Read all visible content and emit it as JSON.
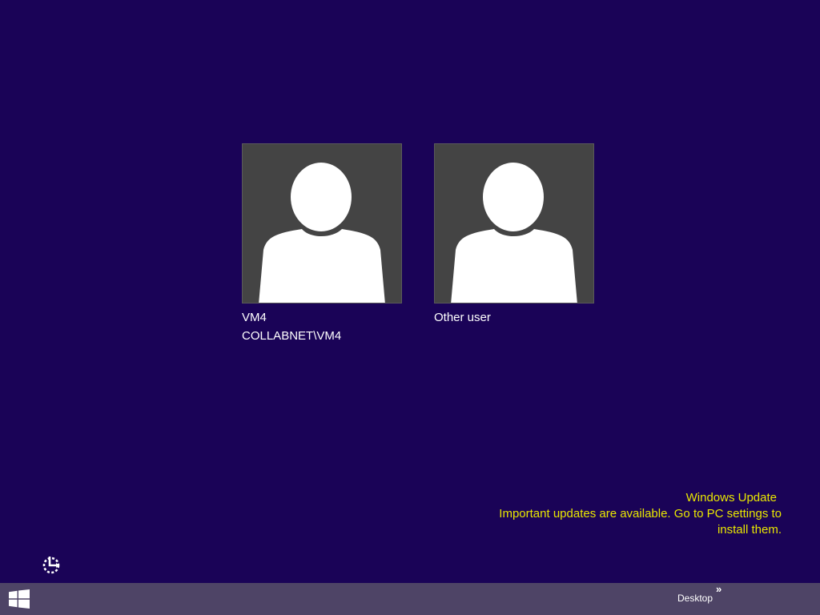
{
  "colors": {
    "background": "#1a0357",
    "tile": "#444444",
    "avatar_silhouette": "#ffffff",
    "notice_text": "#e8e600",
    "taskbar": "#4e4466"
  },
  "accounts": [
    {
      "name": "VM4",
      "domain": "COLLABNET\\VM4",
      "icon": "default-user-avatar-icon"
    },
    {
      "name": "Other user",
      "icon": "default-user-avatar-icon"
    }
  ],
  "notification": {
    "title": "Windows Update",
    "line1": "Important updates are available. Go to PC settings to",
    "line2": "install them."
  },
  "ease_of_access": {
    "icon": "ease-of-access-icon"
  },
  "taskbar": {
    "start_icon": "windows-logo-icon",
    "desktop_label": "Desktop",
    "desktop_chevron": "»"
  }
}
